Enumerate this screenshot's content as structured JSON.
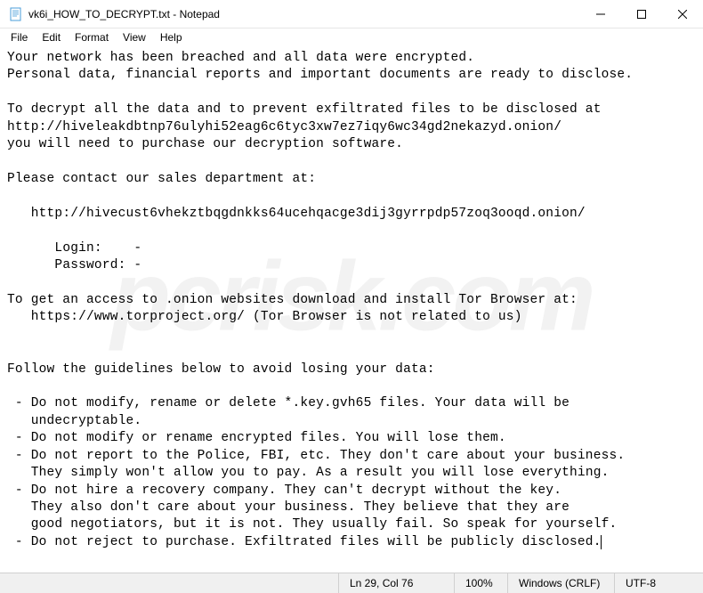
{
  "titlebar": {
    "title": "vk6i_HOW_TO_DECRYPT.txt - Notepad"
  },
  "menu": {
    "file": "File",
    "edit": "Edit",
    "format": "Format",
    "view": "View",
    "help": "Help"
  },
  "content": {
    "text": "Your network has been breached and all data were encrypted.\nPersonal data, financial reports and important documents are ready to disclose.\n\nTo decrypt all the data and to prevent exfiltrated files to be disclosed at \nhttp://hiveleakdbtnp76ulyhi52eag6c6tyc3xw7ez7iqy6wc34gd2nekazyd.onion/\nyou will need to purchase our decryption software.\n\nPlease contact our sales department at:\n\n   http://hivecust6vhekztbqgdnkks64ucehqacge3dij3gyrrpdp57zoq3ooqd.onion/\n\n      Login:    -\n      Password: -\n\nTo get an access to .onion websites download and install Tor Browser at:\n   https://www.torproject.org/ (Tor Browser is not related to us)\n\n\nFollow the guidelines below to avoid losing your data:\n\n - Do not modify, rename or delete *.key.gvh65 files. Your data will be \n   undecryptable.\n - Do not modify or rename encrypted files. You will lose them.\n - Do not report to the Police, FBI, etc. They don't care about your business.\n   They simply won't allow you to pay. As a result you will lose everything.\n - Do not hire a recovery company. They can't decrypt without the key.   \n   They also don't care about your business. They believe that they are \n   good negotiators, but it is not. They usually fail. So speak for yourself.\n - Do not reject to purchase. Exfiltrated files will be publicly disclosed."
  },
  "statusbar": {
    "position": "Ln 29, Col 76",
    "zoom": "100%",
    "eol": "Windows (CRLF)",
    "encoding": "UTF-8"
  },
  "watermark": "pcrisk.com"
}
